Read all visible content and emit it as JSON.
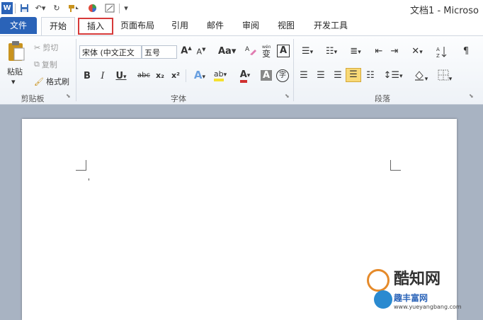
{
  "window": {
    "title": "文档1 - Microso"
  },
  "quick_access": {
    "word_icon": "W"
  },
  "tabs": [
    {
      "label": "文件"
    },
    {
      "label": "开始"
    },
    {
      "label": "插入"
    },
    {
      "label": "页面布局"
    },
    {
      "label": "引用"
    },
    {
      "label": "邮件"
    },
    {
      "label": "审阅"
    },
    {
      "label": "视图"
    },
    {
      "label": "开发工具"
    }
  ],
  "clipboard": {
    "paste": "粘贴",
    "cut": "剪切",
    "copy": "复制",
    "format_painter": "格式刷",
    "label": "剪贴板"
  },
  "font": {
    "name": "宋体 (中文正文",
    "size": "五号",
    "grow": "A",
    "shrink": "A",
    "case": "Aa",
    "bold": "B",
    "italic": "I",
    "underline": "U",
    "strike": "abc",
    "subscript": "x₂",
    "superscript": "x²",
    "effects": "A",
    "highlight": "ab",
    "color": "A",
    "shade": "A",
    "enclose": "字",
    "border": "A",
    "phonetic": "变",
    "label": "字体"
  },
  "paragraph": {
    "label": "段落"
  },
  "watermark": {
    "line1": "酷知网",
    "line2": "趣丰富网",
    "url": "www.yueyangbang.com"
  },
  "colors": {
    "accent": "#2a63b8",
    "highlight_box": "#d63a3a",
    "ribbon_bg": "#eef2f7",
    "doc_bg": "#a8b3c2"
  }
}
